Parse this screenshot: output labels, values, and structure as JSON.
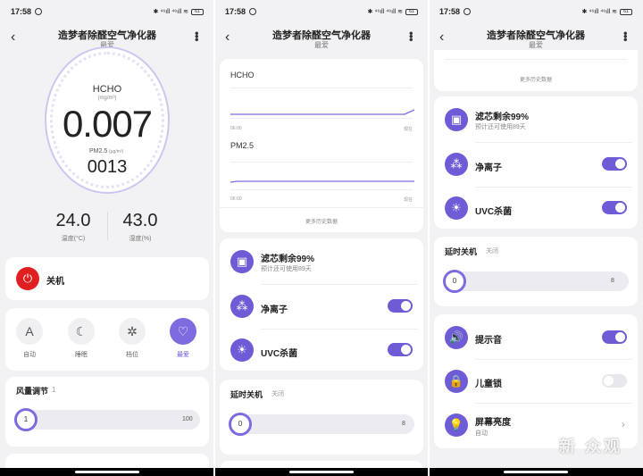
{
  "status_bar": {
    "time": "17:58",
    "signals": "✱ ⁴⁶ıll ⁴⁶ıll ≋",
    "battery": "61"
  },
  "header": {
    "title": "造梦者除醛空气净化器",
    "subtitle": "最爱"
  },
  "screen1": {
    "gauge": {
      "pollutant": "HCHO",
      "pollutant_unit": "(mg/m³)",
      "value": "0.007",
      "pm_label": "PM2.5",
      "pm_unit": "(μg/m³)",
      "pm_value": "0013"
    },
    "temperature": {
      "value": "24.0",
      "label": "温度(°C)"
    },
    "humidity": {
      "value": "43.0",
      "label": "湿度(%)"
    },
    "power": {
      "label": "关机"
    },
    "modes": [
      {
        "label": "自动",
        "icon": "auto-icon",
        "glyph": "A",
        "active": false
      },
      {
        "label": "睡眠",
        "icon": "moon-icon",
        "glyph": "☾",
        "active": false
      },
      {
        "label": "档位",
        "icon": "fan-icon",
        "glyph": "✲",
        "active": false
      },
      {
        "label": "最爱",
        "icon": "heart-icon",
        "glyph": "♡",
        "active": true
      }
    ],
    "fan": {
      "title": "风量调节",
      "value": "1",
      "min": "1",
      "max": "100"
    }
  },
  "screen2": {
    "charts": [
      {
        "title": "HCHO",
        "x_start": "06:00",
        "x_end": "现在"
      },
      {
        "title": "PM2.5",
        "x_start": "06:00",
        "x_end": "现在"
      }
    ],
    "more_history": "更多历史数据",
    "filter": {
      "title": "滤芯剩余99%",
      "subtitle": "预计还可使用89天"
    },
    "ionizer": {
      "label": "净离子",
      "on": true
    },
    "uvc": {
      "label": "UVC杀菌",
      "on": true
    },
    "timer": {
      "title": "延时关机",
      "state": "关闭",
      "value": "0",
      "max": "8"
    }
  },
  "screen3": {
    "more_history": "更多历史数据",
    "filter": {
      "title": "滤芯剩余99%",
      "subtitle": "预计还可使用89天"
    },
    "ionizer": {
      "label": "净离子",
      "on": true
    },
    "uvc": {
      "label": "UVC杀菌",
      "on": true
    },
    "timer": {
      "title": "延时关机",
      "state": "关闭",
      "value": "0",
      "max": "8"
    },
    "sound": {
      "label": "提示音",
      "on": true
    },
    "child_lock": {
      "label": "儿童锁",
      "on": false
    },
    "brightness": {
      "label": "屏幕亮度",
      "value": "自动"
    }
  },
  "watermark": "新 众观",
  "colors": {
    "accent": "#6e5bd6",
    "power_red": "#e02020",
    "background": "#f2f2f4"
  }
}
